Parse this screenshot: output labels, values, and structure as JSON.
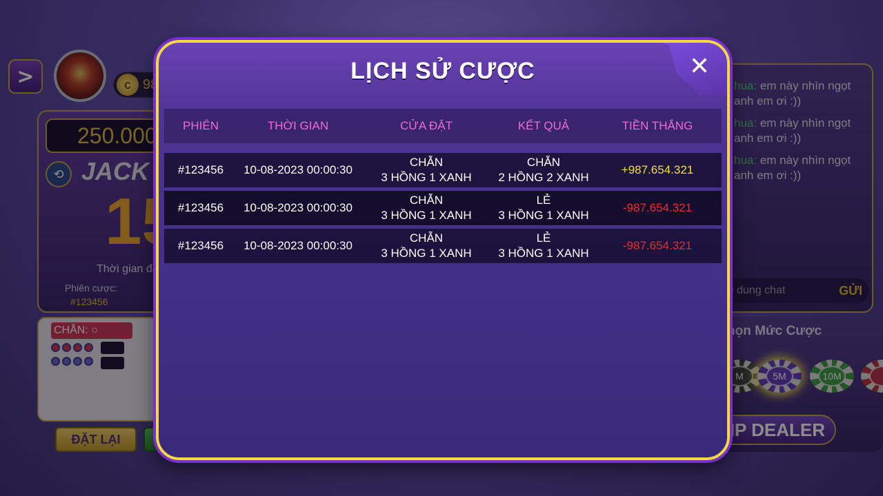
{
  "background": {
    "back_button": ">",
    "coin_value_partial": "98",
    "jackpot_amount_partial": "250.000",
    "jackpot_word_partial": "JACK",
    "countdown_partial": "15",
    "bet_time_label_partial": "Thời gian đặ",
    "session_label": "Phiên cược:",
    "session_id": "#123456",
    "chan_tag": "CHẴN:",
    "reset_button": "ĐẶT LẠI",
    "chat": [
      {
        "name": "hua:",
        "text": "em này nhìn ngọt",
        "text2": "anh em ơi :))"
      },
      {
        "name": "hua:",
        "text": "em này nhìn ngọt",
        "text2": "anh em ơi :))"
      },
      {
        "name": "hua:",
        "text": "em này nhìn ngọt",
        "text2": "anh em ơi :))"
      }
    ],
    "chat_placeholder_partial": "i dung chat",
    "send_button": "GỬI",
    "bet_level_title_partial": "họn Mức Cược",
    "chips": [
      "M",
      "5M",
      "10M"
    ],
    "tip_button_partial": "IP DEALER"
  },
  "modal": {
    "title": "LỊCH SỬ CƯỢC",
    "close_icon": "✕",
    "headers": [
      "PHIÊN",
      "THỜI GIAN",
      "CỬA ĐẶT",
      "KẾT QUẢ",
      "TIỀN THẮNG"
    ],
    "rows": [
      {
        "session": "#123456",
        "time": "10-08-2023 00:00:30",
        "bet_line1": "CHẴN",
        "bet_line2": "3 HỒNG 1 XANH",
        "result_line1": "CHẴN",
        "result_line2": "2 HỒNG 2 XANH",
        "win": "+987.654.321",
        "win_color": "#f2e030"
      },
      {
        "session": "#123456",
        "time": "10-08-2023 00:00:30",
        "bet_line1": "CHẴN",
        "bet_line2": "3 HỒNG 1 XANH",
        "result_line1": "LẺ",
        "result_line2": "3 HỒNG 1 XANH",
        "win": "-987.654.321",
        "win_color": "#ee2a2a"
      },
      {
        "session": "#123456",
        "time": "10-08-2023 00:00:30",
        "bet_line1": "CHẴN",
        "bet_line2": "3 HỒNG 1 XANH",
        "result_line1": "LẺ",
        "result_line2": "3 HỒNG 1 XANH",
        "win": "-987.654.321",
        "win_color": "#ee2a2a"
      }
    ]
  },
  "colors": {
    "modal_border": "#f2da40",
    "header_text": "#f06ad8",
    "win_positive": "#f2e030",
    "win_negative": "#ee2a2a",
    "gold": "#c9a640"
  }
}
